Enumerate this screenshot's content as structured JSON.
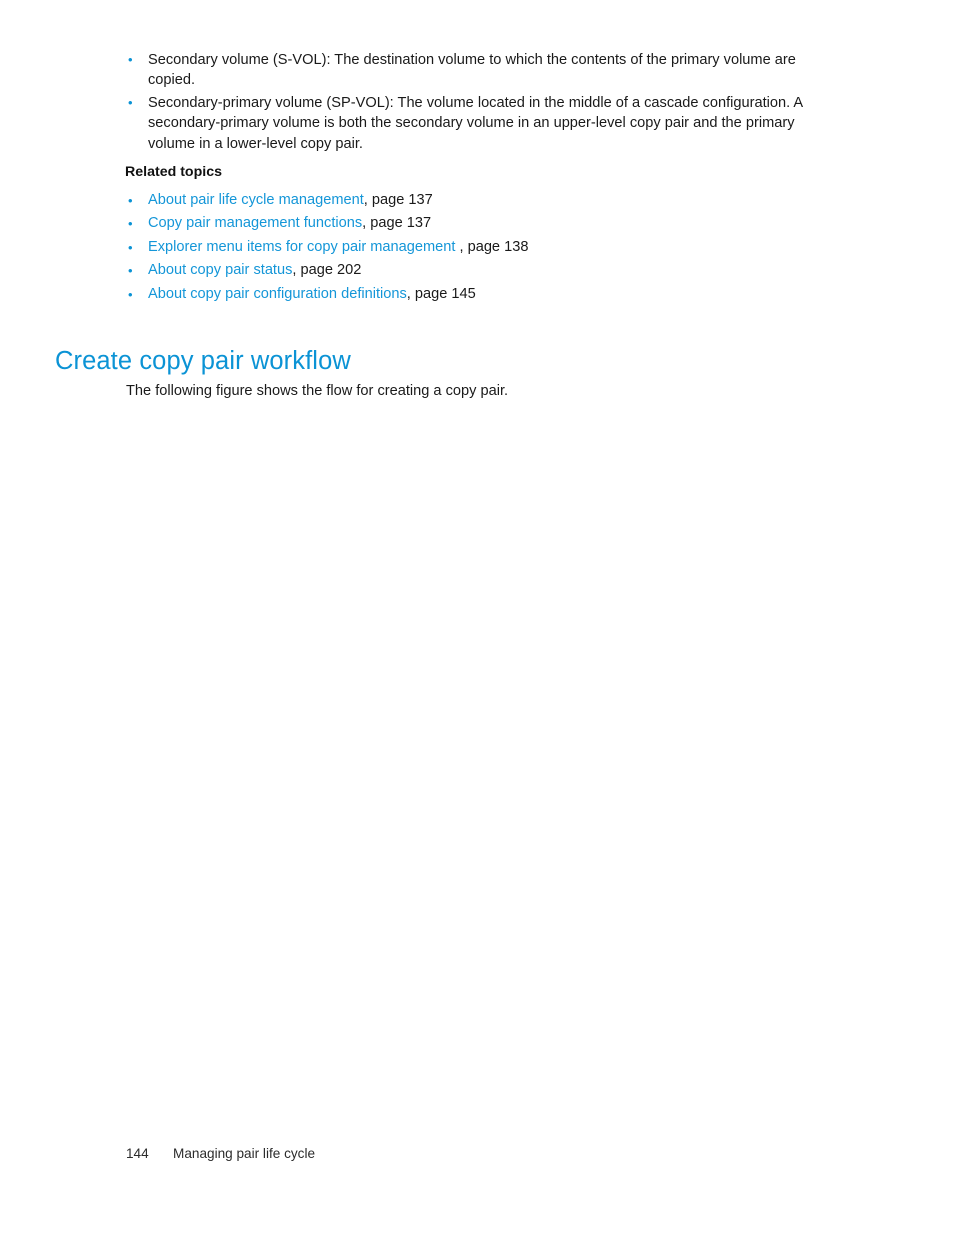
{
  "document": {
    "background_color": "#ffffff",
    "accent_color": "#0b93d5",
    "link_color": "#1496d8",
    "text_color": "#1a1a1a"
  },
  "intro_bullets": [
    "Secondary volume (S-VOL): The destination volume to which the contents of the primary volume are copied.",
    "Secondary-primary volume (SP-VOL): The volume located in the middle of a cascade configuration. A secondary-primary volume is both the secondary volume in an upper-level copy pair and the primary volume in a lower-level copy pair."
  ],
  "related_topics": {
    "heading": "Related topics",
    "items": [
      {
        "link": "About pair life cycle management",
        "tail": ", page 137"
      },
      {
        "link": "Copy pair management functions",
        "tail": ", page 137"
      },
      {
        "link": "Explorer menu items for copy pair management",
        "tail": " , page 138"
      },
      {
        "link": "About copy pair status",
        "tail": ", page 202"
      },
      {
        "link": "About copy pair configuration definitions",
        "tail": ", page 145"
      }
    ]
  },
  "section": {
    "heading": "Create copy pair workflow",
    "body": "The following figure shows the flow for creating a copy pair."
  },
  "footer": {
    "page_number": "144",
    "chapter_title": "Managing pair life cycle"
  }
}
